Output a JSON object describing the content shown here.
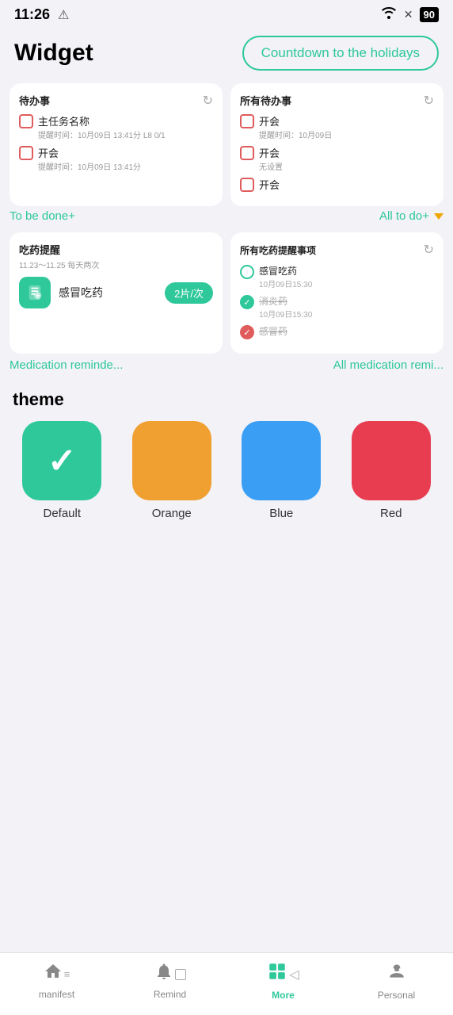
{
  "statusBar": {
    "time": "11:26",
    "alertIcon": "⚠",
    "wifiIcon": "📶",
    "simIcon": "✕",
    "battery": "90"
  },
  "header": {
    "title": "Widget",
    "countdownBtn": "Countdown to the holidays"
  },
  "cards": {
    "todoCard": {
      "title": "待办事",
      "items": [
        {
          "name": "主任务名称",
          "reminder": "提醒时间：10月09日 13:41分 L8 0/1"
        },
        {
          "name": "开会",
          "reminder": "提醒时间：10月09日 13:41分"
        }
      ]
    },
    "allTodoCard": {
      "title": "所有待办事",
      "items": [
        {
          "name": "开会",
          "reminder": "提醒时间：10月09日",
          "state": "unchecked"
        },
        {
          "name": "开会",
          "note": "无设置",
          "state": "unchecked"
        },
        {
          "name": "开会",
          "state": "unchecked"
        }
      ]
    },
    "toBeLink": "To be done+",
    "allToDoLink": "All to do+",
    "medCard": {
      "title": "吃药提醒",
      "schedule": "11.23～11.25 每天两次",
      "itemName": "感冒吃药",
      "dose": "2片/次"
    },
    "allMedCard": {
      "title": "所有吃药提醒事项",
      "items": [
        {
          "name": "感冒吃药",
          "date": "10月09日15:30",
          "state": "unchecked"
        },
        {
          "name": "消炎药",
          "date": "10月09日15:30",
          "state": "checked-green"
        },
        {
          "name": "感冒药",
          "state": "checked-red"
        }
      ]
    },
    "medLink": "Medication reminde...",
    "allMedLink": "All medication remi..."
  },
  "theme": {
    "title": "theme",
    "items": [
      {
        "label": "Default",
        "color": "#2ec89a",
        "selected": true
      },
      {
        "label": "Orange",
        "color": "#f0a030",
        "selected": false
      },
      {
        "label": "Blue",
        "color": "#3a9ef5",
        "selected": false
      },
      {
        "label": "Red",
        "color": "#e83c50",
        "selected": false
      }
    ]
  },
  "bottomNav": {
    "items": [
      {
        "label": "manifest",
        "icon": "🏠",
        "active": false
      },
      {
        "label": "Remind",
        "icon": "⏰",
        "active": false
      },
      {
        "label": "More",
        "icon": "⊞",
        "active": true
      },
      {
        "label": "Personal",
        "icon": "😶",
        "active": false
      }
    ]
  }
}
